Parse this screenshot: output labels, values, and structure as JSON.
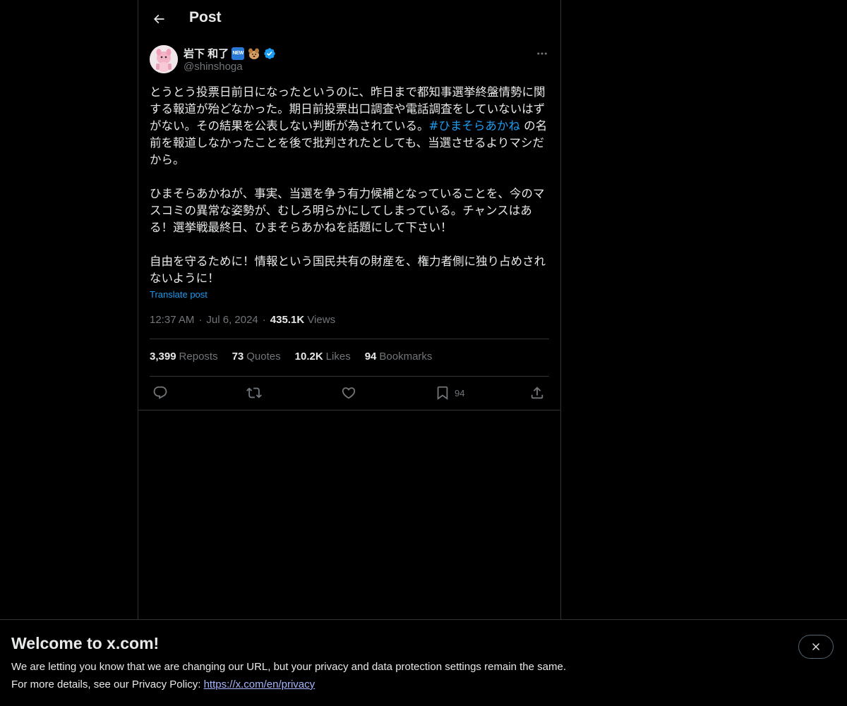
{
  "header": {
    "title": "Post",
    "back_icon": "arrow-left-icon"
  },
  "author": {
    "name": "岩下 和了",
    "badge_text": "NEW",
    "handle": "@shinshoga"
  },
  "post": {
    "text_before_hashtag": "とうとう投票日前日になったというのに、昨日まで都知事選挙終盤情勢に関する報道が殆どなかった。期日前投票出口調査や電話調査をしていないはずがない。その結果を公表しない判断が為されている。",
    "hashtag": "#ひまそらあかね",
    "text_after_hashtag": " の名前を報道しなかったことを後で批判されたとしても、当選させるよりマシだから。\n\nひまそらあかねが、事実、当選を争う有力候補となっていることを、今のマスコミの異常な姿勢が、むしろ明らかにしてしまっている。チャンスはある！選挙戦最終日、ひまそらあかねを話題にして下さい！\n\n自由を守るために！情報という国民共有の財産を、権力者側に独り占めされないように！",
    "translate_label": "Translate post",
    "time": "12:37 AM",
    "date": "Jul 6, 2024",
    "views_count": "435.1K",
    "views_label": "Views"
  },
  "stats": {
    "reposts_count": "3,399",
    "reposts_label": "Reposts",
    "quotes_count": "73",
    "quotes_label": "Quotes",
    "likes_count": "10.2K",
    "likes_label": "Likes",
    "bookmarks_count": "94",
    "bookmarks_label": "Bookmarks"
  },
  "actions": {
    "reply_icon": "reply-icon",
    "repost_icon": "repost-icon",
    "like_icon": "heart-icon",
    "bookmark_icon": "bookmark-icon",
    "bookmark_count": "94",
    "share_icon": "share-icon"
  },
  "banner": {
    "title": "Welcome to x.com!",
    "line1": "We are letting you know that we are changing our URL, but your privacy and data protection settings remain the same.",
    "line2_prefix": "For more details, see our Privacy Policy: ",
    "link_text": "https://x.com/en/privacy",
    "close_icon": "close-icon"
  },
  "colors": {
    "background": "#000000",
    "text_primary": "#e7e9ea",
    "text_secondary": "#71767b",
    "accent": "#1d9bf0",
    "border": "#2f3336"
  }
}
